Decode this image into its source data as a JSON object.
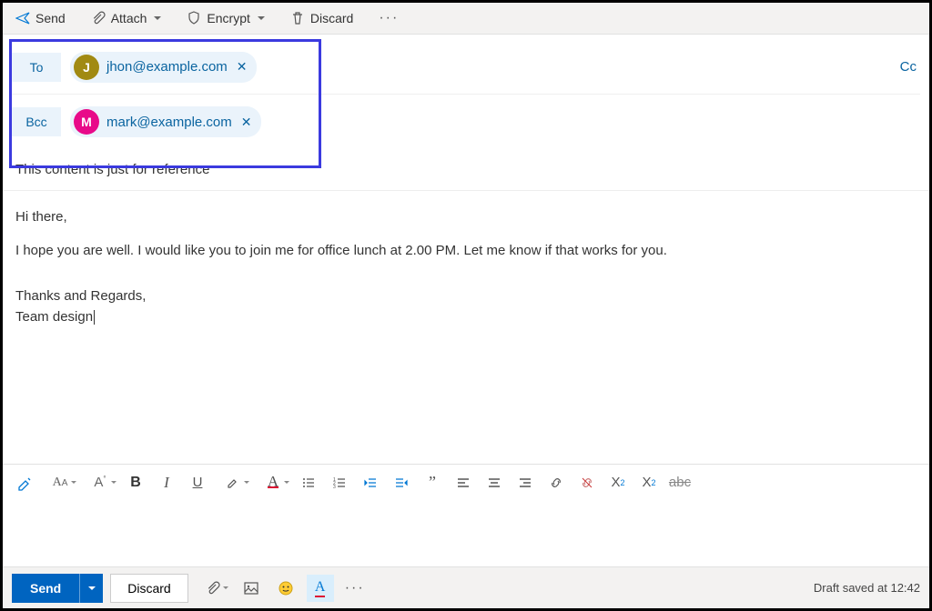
{
  "toolbar": {
    "send": "Send",
    "attach": "Attach",
    "encrypt": "Encrypt",
    "discard": "Discard"
  },
  "recipients": {
    "to_label": "To",
    "bcc_label": "Bcc",
    "cc_label": "Cc",
    "to": {
      "initial": "J",
      "email": "jhon@example.com",
      "avatar_color": "#a18a13"
    },
    "bcc": {
      "initial": "M",
      "email": "mark@example.com",
      "avatar_color": "#e80a89"
    }
  },
  "subject": "This content is just for reference",
  "body": {
    "greeting": "Hi there,",
    "p1": "I hope you are well. I would like you to join me for office lunch at 2.00 PM. Let me know if that works for you.",
    "sig1": "Thanks and Regards,",
    "sig2": "Team design"
  },
  "bottom": {
    "send": "Send",
    "discard": "Discard",
    "status": "Draft saved at 12:42"
  },
  "fmt_icons": {
    "bold": "B",
    "italic": "I",
    "underline": "U",
    "font_color": "A",
    "quote": "”",
    "strike": "abc",
    "super": "X",
    "sub": "X",
    "sup_exp": "2",
    "sub_exp": "2"
  }
}
